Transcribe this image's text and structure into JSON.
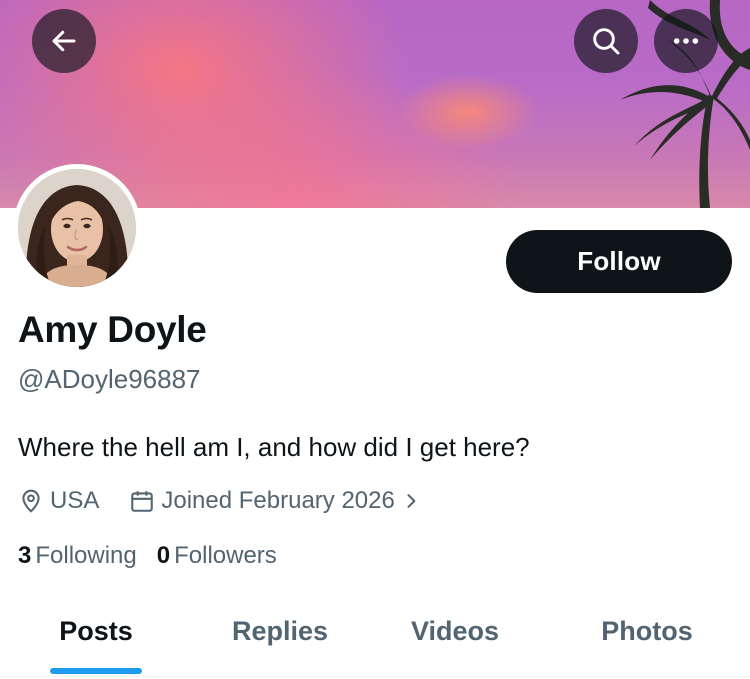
{
  "profile": {
    "name": "Amy Doyle",
    "handle": "@ADoyle96887",
    "bio": "Where the hell am I, and how did I get here?",
    "location": "USA",
    "joined": "Joined February 2026",
    "following_count": "3",
    "following_label": "Following",
    "followers_count": "0",
    "followers_label": "Followers"
  },
  "actions": {
    "follow_label": "Follow"
  },
  "tabs": [
    {
      "label": "Posts",
      "active": true
    },
    {
      "label": "Replies",
      "active": false
    },
    {
      "label": "Videos",
      "active": false
    },
    {
      "label": "Photos",
      "active": false
    }
  ],
  "icons": {
    "back": "arrow-left-icon",
    "search": "search-icon",
    "more": "more-horizontal-icon",
    "location": "location-pin-icon",
    "calendar": "calendar-icon",
    "chevron": "chevron-right-icon"
  },
  "colors": {
    "text_primary": "#0f1419",
    "text_secondary": "#536471",
    "accent": "#1d9bf0",
    "follow_button": "#0f1419"
  }
}
